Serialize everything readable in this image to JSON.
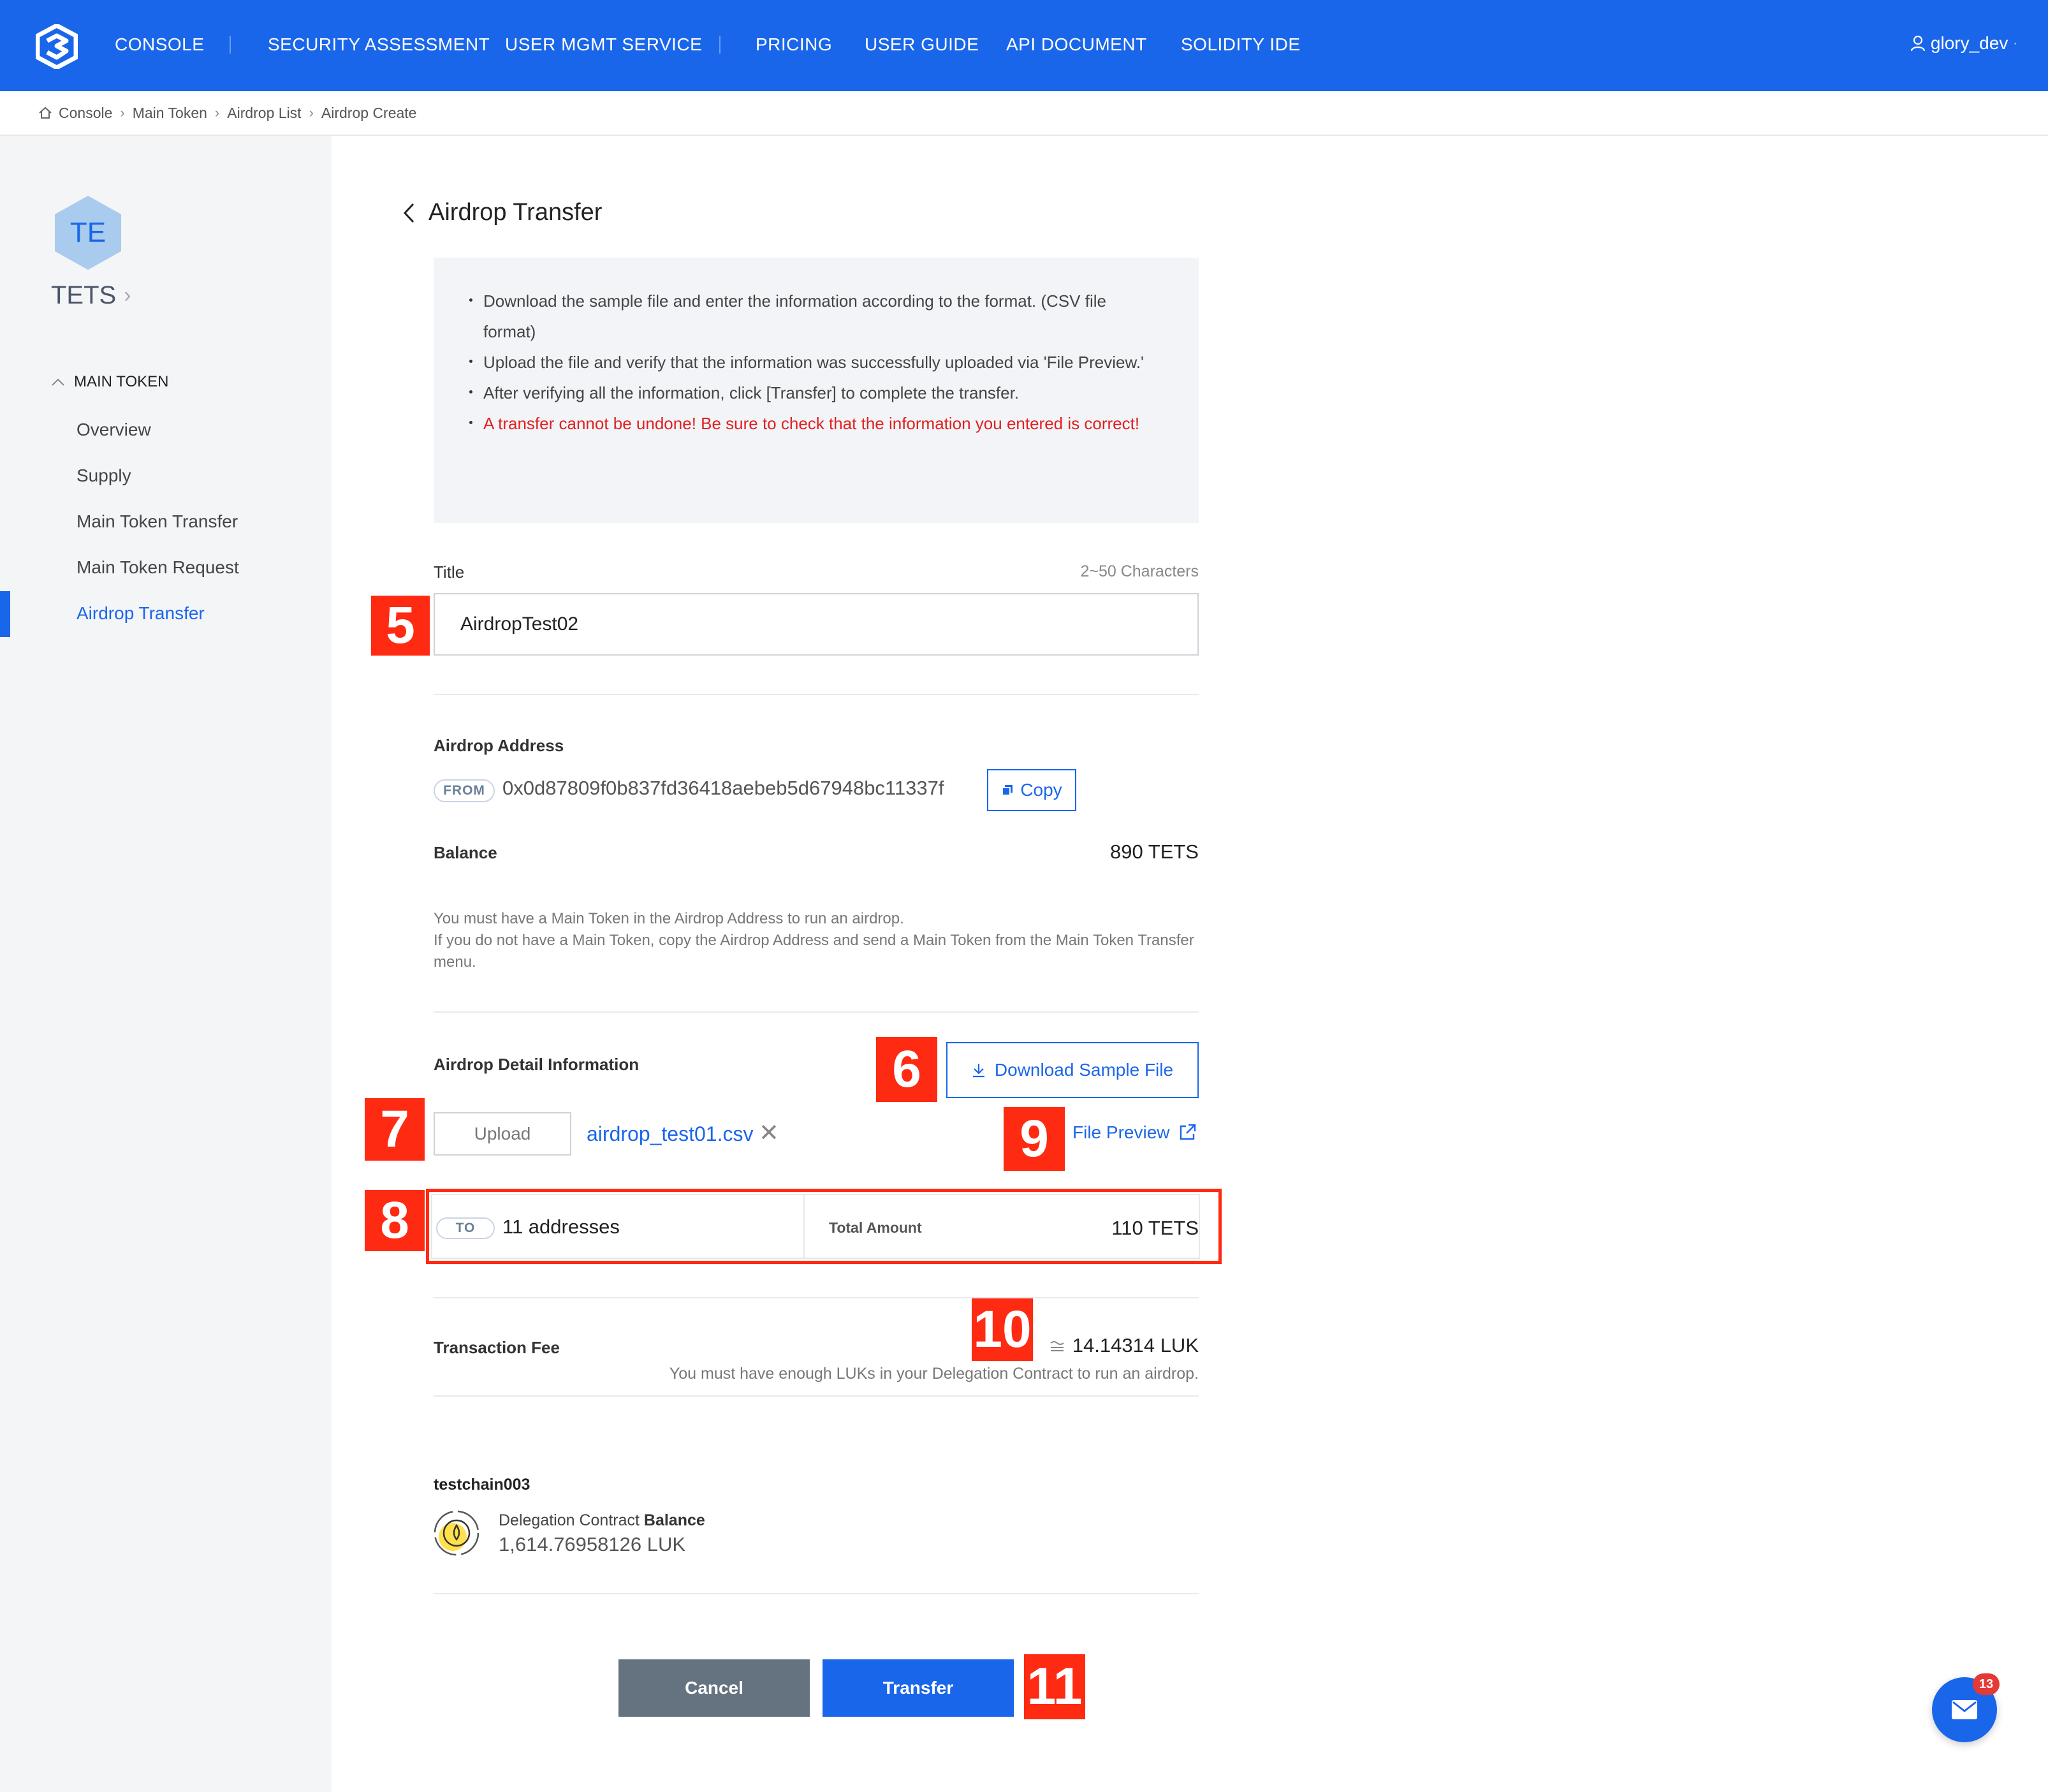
{
  "nav": {
    "items": [
      "CONSOLE",
      "SECURITY ASSESSMENT",
      "USER MGMT SERVICE",
      "PRICING",
      "USER GUIDE",
      "API DOCUMENT",
      "SOLIDITY IDE"
    ],
    "user": "glory_dev"
  },
  "breadcrumb": [
    "Console",
    "Main Token",
    "Airdrop List",
    "Airdrop Create"
  ],
  "sidebar": {
    "token_abbr": "TE",
    "token_name": "TETS",
    "section": "MAIN TOKEN",
    "items": [
      "Overview",
      "Supply",
      "Main Token Transfer",
      "Main Token Request",
      "Airdrop Transfer"
    ]
  },
  "page": {
    "title": "Airdrop Transfer",
    "info": [
      "Download the sample file and enter the information according to the format. (CSV file format)",
      "Upload the file and verify that the information was successfully uploaded via 'File Preview.'",
      "After verifying all the information, click [Transfer] to complete the transfer.",
      "A transfer cannot be undone! Be sure to check that the information you entered is correct!"
    ],
    "title_label": "Title",
    "title_hint": "2~50 Characters",
    "title_value": "AirdropTest02",
    "airdrop_address_label": "Airdrop Address",
    "from_tag": "FROM",
    "address": "0x0d87809f0b837fd36418aebeb5d67948bc11337f",
    "copy_label": "Copy",
    "balance_label": "Balance",
    "balance_value": "890 TETS",
    "note_line1": "You must have a Main Token in the Airdrop Address to run an airdrop.",
    "note_line2": "If you do not have a Main Token, copy the Airdrop Address and send a Main Token from the Main Token Transfer menu.",
    "detail_label": "Airdrop Detail Information",
    "download_label": "Download Sample File",
    "upload_label": "Upload",
    "file_name": "airdrop_test01.csv",
    "file_preview_label": "File Preview",
    "to_tag": "TO",
    "address_count": "11 addresses",
    "total_amount_label": "Total Amount",
    "total_amount_value": "110 TETS",
    "fee_label": "Transaction Fee",
    "fee_value": "14.14314 LUK",
    "fee_note": "You must have enough LUKs in your Delegation Contract to run an airdrop.",
    "chain_name": "testchain003",
    "deleg_label_prefix": "Delegation Contract ",
    "deleg_label_bold": "Balance",
    "deleg_value": "1,614.76958126 LUK",
    "cancel_label": "Cancel",
    "transfer_label": "Transfer"
  },
  "markers": [
    "5",
    "6",
    "7",
    "8",
    "9",
    "10",
    "11"
  ],
  "chat": {
    "badge": "13"
  },
  "colors": {
    "brand": "#1a66ea",
    "marker": "#ff2a12",
    "warning": "#e02020",
    "cancel": "#657380"
  }
}
